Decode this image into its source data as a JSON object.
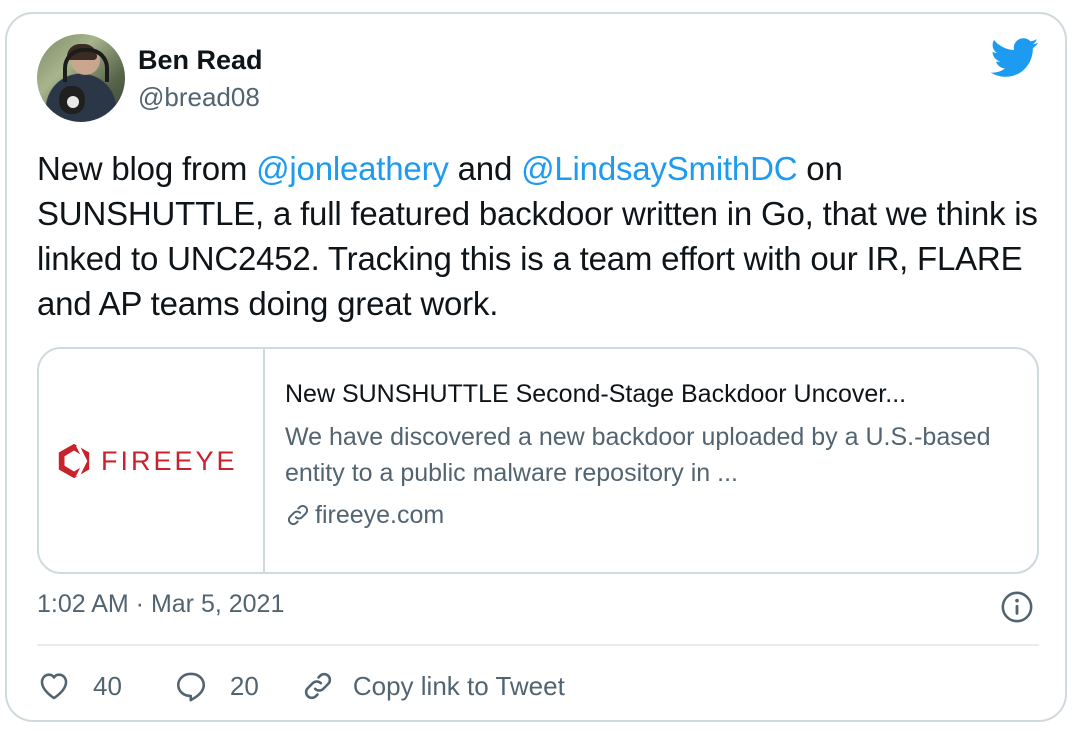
{
  "author": {
    "display_name": "Ben Read",
    "handle": "@bread08"
  },
  "tweet": {
    "text_1": "New blog from ",
    "mention_1": "@jonleathery",
    "text_2": " and ",
    "mention_2": "@LindsaySmithDC",
    "text_3": " on SUNSHUTTLE, a full featured backdoor written in Go, that we think is linked to UNC2452. Tracking this is a team effort with our IR, FLARE and AP teams doing great work."
  },
  "link_card": {
    "logo_text": "FIREEYE",
    "title": "New SUNSHUTTLE Second-Stage Backdoor Uncover...",
    "description": "We have discovered a new backdoor uploaded by a U.S.-based entity to a public malware repository in ...",
    "domain": "fireeye.com"
  },
  "meta": {
    "timestamp": "1:02 AM · Mar 5, 2021"
  },
  "actions": {
    "likes": "40",
    "replies": "20",
    "copy_label": "Copy link to Tweet"
  },
  "colors": {
    "accent": "#1d9bf0",
    "text": "#0f1419",
    "secondary": "#536471",
    "border": "#cfd9de",
    "brand_fireeye": "#c8232c"
  },
  "icons": [
    "twitter-bird-icon",
    "link-icon",
    "info-icon",
    "heart-icon",
    "reply-bubble-icon",
    "copy-link-icon"
  ]
}
